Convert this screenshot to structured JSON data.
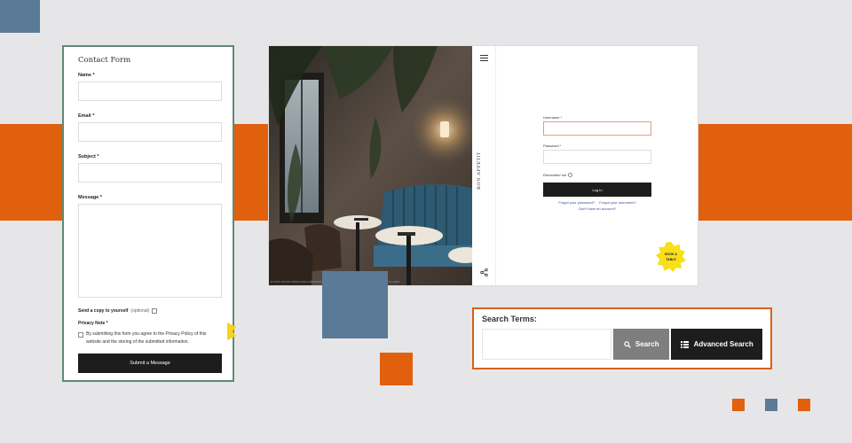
{
  "contact_form": {
    "title": "Contact Form",
    "name_label": "Name *",
    "email_label": "Email *",
    "subject_label": "Subject *",
    "message_label": "Message *",
    "copy_label": "Send a copy to yourself",
    "copy_optional": "(optional)",
    "privacy_title": "Privacy Note *",
    "privacy_text": "By submitting this form you agree to the Privacy Policy of this website and the storing of the submitted information.",
    "submit_label": "Submit a Message"
  },
  "login": {
    "brand": "BON APPETIT",
    "username_label": "Username *",
    "password_label": "Password *",
    "remember_label": "Remember me",
    "login_button": "Log In",
    "forgot_password": "Forgot your password?",
    "forgot_username": "Forgot your username?",
    "no_account": "Don't have an account?",
    "book_badge_line1": "BOOK A",
    "book_badge_line2": "TABLE"
  },
  "photo": {
    "caption": "HTTPS://COM.UNSPLASH.COM/PHOTO-1...INTERIOR-RESTAURANT-SEATING-BOOTH-LAMP"
  },
  "search": {
    "title": "Search Terms:",
    "search_button": "Search",
    "advanced_button": "Advanced Search"
  },
  "colors": {
    "accent_orange": "#e0600e",
    "accent_blue": "#5b7a97",
    "form_border_green": "#5f8a72",
    "badge_yellow": "#f7e017"
  }
}
